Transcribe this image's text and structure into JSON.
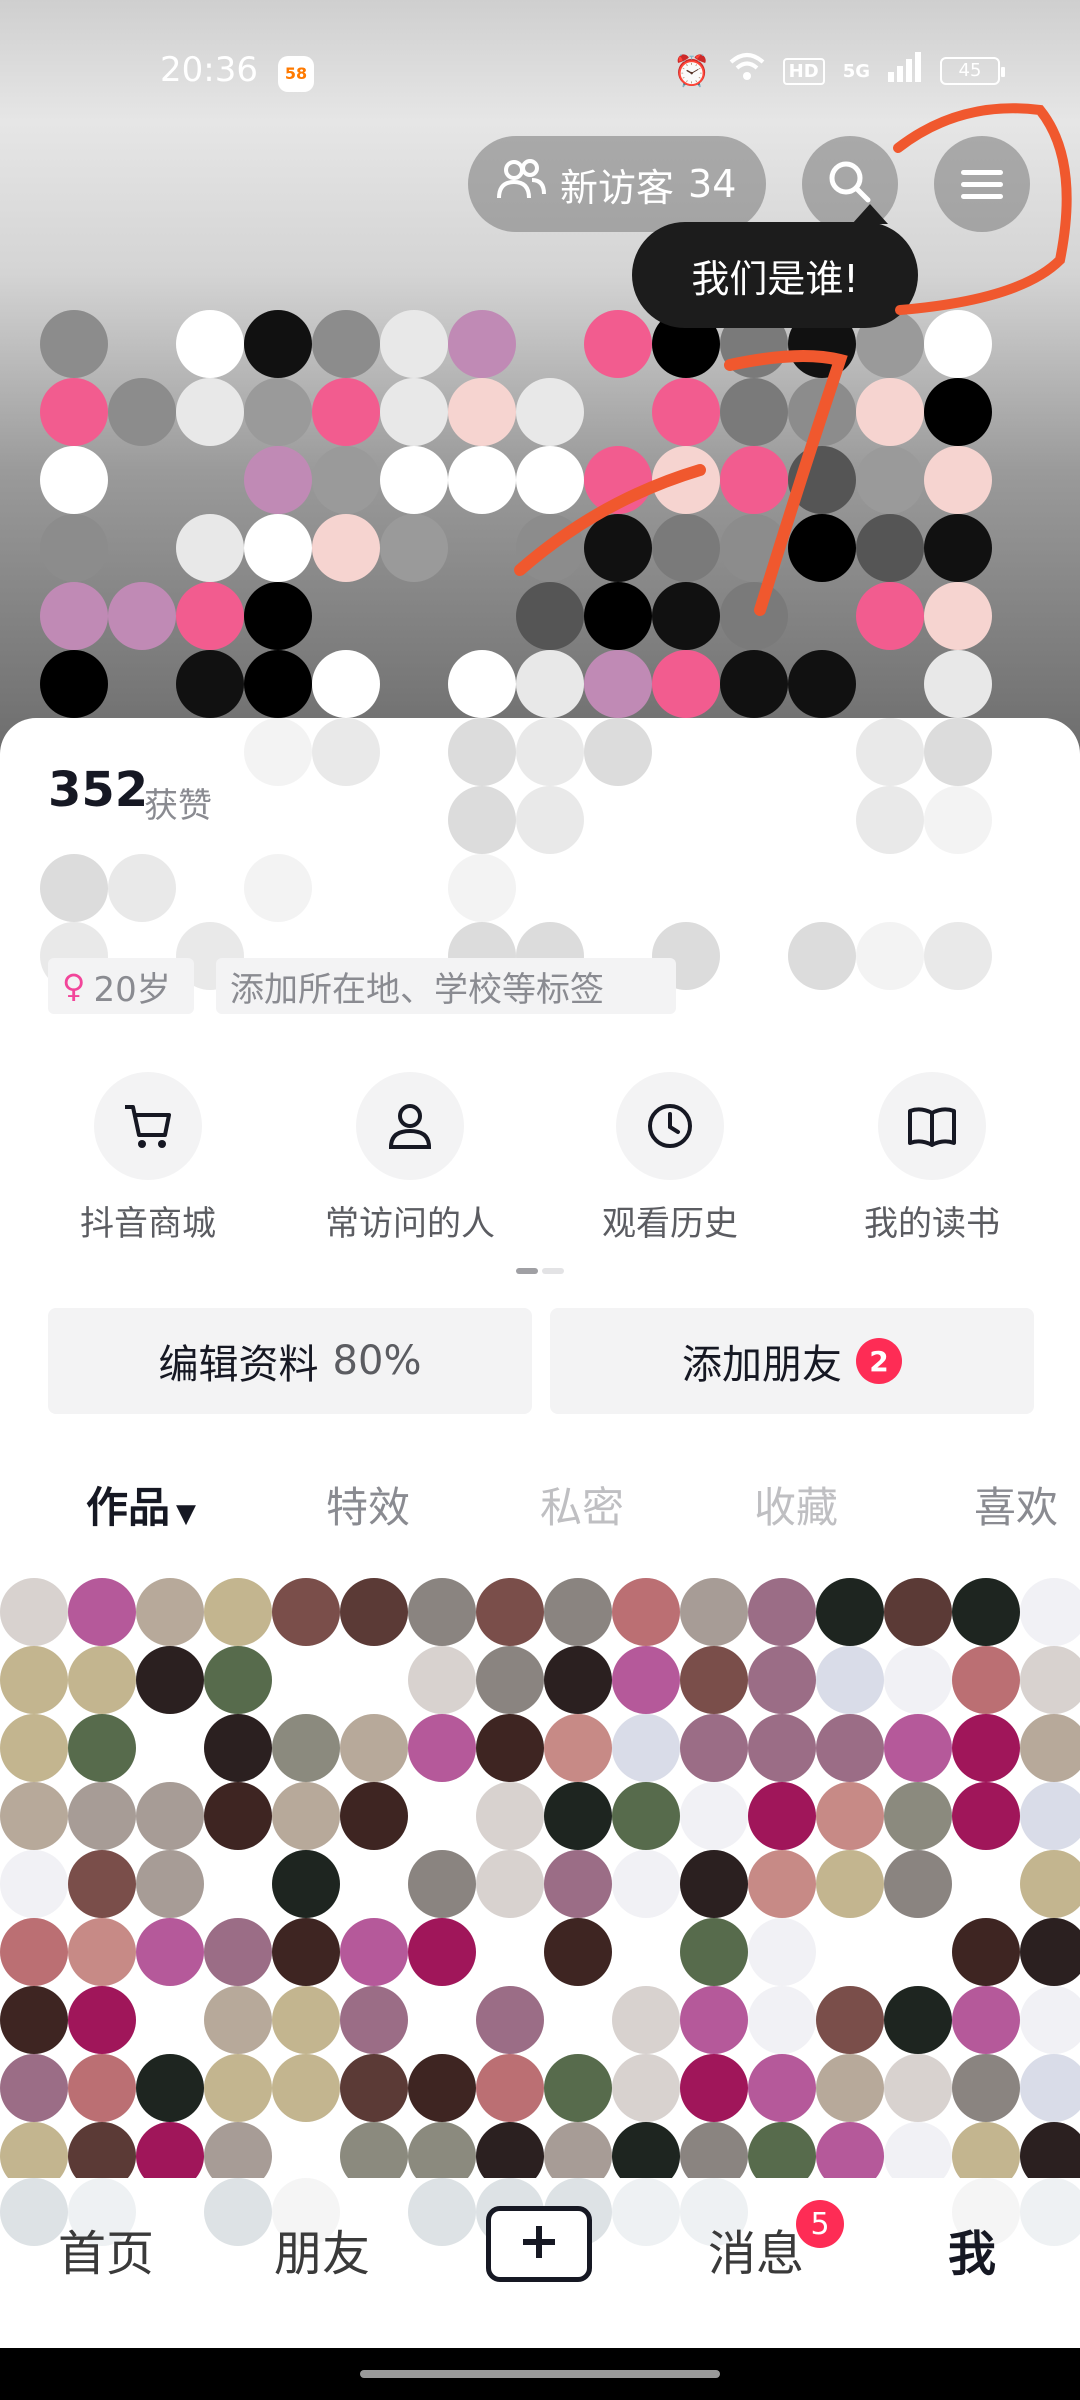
{
  "status_bar": {
    "time": "20:36",
    "app_badge": "58",
    "hd": "HD",
    "network": "5G",
    "battery": "45"
  },
  "header": {
    "visitor_label": "新访客",
    "visitor_count": "34",
    "tooltip": "我们是谁!",
    "accent_color": "#fe2c55"
  },
  "profile": {
    "likes_count": "352",
    "likes_label": "获赞",
    "age_tag": "20岁",
    "tag_hint": "添加所在地、学校等标签"
  },
  "shortcuts": [
    {
      "label": "抖音商城",
      "icon": "cart-icon"
    },
    {
      "label": "常访问的人",
      "icon": "person-icon"
    },
    {
      "label": "观看历史",
      "icon": "clock-icon"
    },
    {
      "label": "我的读书",
      "icon": "book-icon"
    }
  ],
  "actions": {
    "edit_label": "编辑资料",
    "edit_progress": "80%",
    "add_friend_label": "添加朋友",
    "add_friend_badge": "2"
  },
  "tabs": [
    {
      "label": "作品",
      "active": true
    },
    {
      "label": "特效",
      "active": false
    },
    {
      "label": "私密",
      "active": false
    },
    {
      "label": "收藏",
      "active": false
    },
    {
      "label": "喜欢",
      "active": false
    }
  ],
  "bottom_nav": {
    "home": "首页",
    "friends": "朋友",
    "messages": "消息",
    "messages_badge": "5",
    "me": "我"
  }
}
